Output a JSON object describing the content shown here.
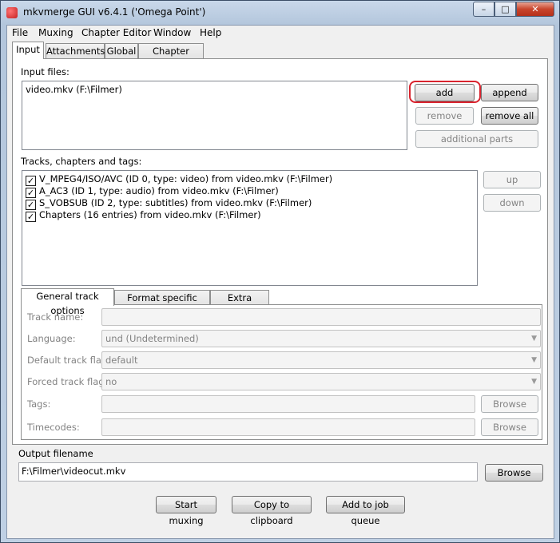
{
  "window": {
    "title": "mkvmerge GUI v6.4.1 ('Omega Point')",
    "controls": {
      "minimize": "–",
      "maximize": "□",
      "close": "✕"
    }
  },
  "menu": [
    "File",
    "Muxing",
    "Chapter Editor",
    "Window",
    "Help"
  ],
  "tabs": [
    "Input",
    "Attachments",
    "Global",
    "Chapter Editor"
  ],
  "input": {
    "files_label": "Input files:",
    "files": [
      "video.mkv (F:\\Filmer)"
    ],
    "buttons": {
      "add": "add",
      "append": "append",
      "remove": "remove",
      "remove_all": "remove all",
      "additional_parts": "additional parts"
    },
    "tracks_label": "Tracks, chapters and tags:",
    "tracks": [
      {
        "label": "V_MPEG4/ISO/AVC (ID 0, type: video) from video.mkv (F:\\Filmer)",
        "checked": true
      },
      {
        "label": "A_AC3 (ID 1, type: audio) from video.mkv (F:\\Filmer)",
        "checked": true
      },
      {
        "label": "S_VOBSUB (ID 2, type: subtitles) from video.mkv (F:\\Filmer)",
        "checked": true
      },
      {
        "label": "Chapters (16 entries) from video.mkv (F:\\Filmer)",
        "checked": true
      }
    ],
    "track_buttons": {
      "up": "up",
      "down": "down"
    },
    "option_tabs": [
      "General track options",
      "Format specific options",
      "Extra options"
    ],
    "options": {
      "track_name_label": "Track name:",
      "track_name_value": "",
      "language_label": "Language:",
      "language_value": "und (Undetermined)",
      "default_flag_label": "Default track flag:",
      "default_flag_value": "default",
      "forced_flag_label": "Forced track flag:",
      "forced_flag_value": "no",
      "tags_label": "Tags:",
      "tags_value": "",
      "timecodes_label": "Timecodes:",
      "timecodes_value": "",
      "browse": "Browse"
    }
  },
  "output": {
    "label": "Output filename",
    "value": "F:\\Filmer\\videocut.mkv",
    "browse": "Browse"
  },
  "actions": {
    "start": "Start muxing",
    "copy": "Copy to clipboard",
    "queue": "Add to job queue"
  },
  "colors": {
    "highlight": "#d9232e",
    "titlebar": "#c9d8ea"
  }
}
